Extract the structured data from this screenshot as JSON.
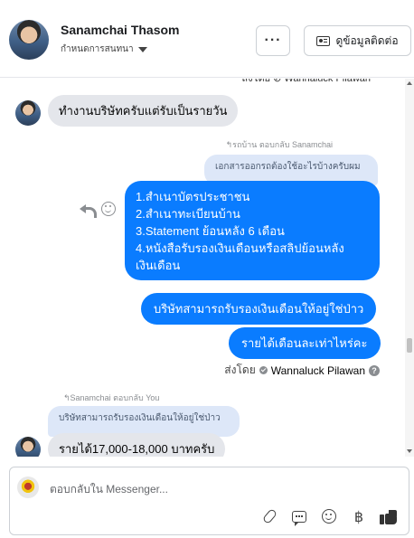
{
  "header": {
    "name": "Sanamchai Thasom",
    "subtitle": "กำหนดการสนทนา",
    "more_label": "···",
    "contact_label": "ดูข้อมูลติดต่อ"
  },
  "thread": {
    "cut_top_sender": "ส่งโดย ⊘ Wannaluck Pilawan",
    "messages": {
      "m1": {
        "text": "ทำงานบริษัทครับแต่รับเป็นรายวัน"
      },
      "m2": {
        "reply_label": "↰รถบ้าน ตอบกลับ Sanamchai",
        "quote": "เอกสารออกรถต้องใช้อะไรบ้างครับผม",
        "lines": [
          "1.สำเนาบัตรประชาชน",
          "2.สำเนาทะเบียนบ้าน",
          "3.Statement ย้อนหลัง 6 เดือน",
          "4.หนังสือรับรองเงินเดือนหรือสลิปย้อนหลัง",
          "เงินเดือน"
        ]
      },
      "m3": {
        "text": "บริษัทสามารถรับรองเงินเดือนให้อยู่ใช่ป่าว"
      },
      "m4": {
        "text": "รายได้เดือนละเท่าไหร่คะ"
      },
      "sent_by": {
        "prefix": "ส่งโดย",
        "name": "Wannaluck Pilawan",
        "help": "?"
      },
      "m5": {
        "reply_label": "↰Sanamchai ตอบกลับ You",
        "quote": "บริษัทสามารถรับรองเงินเดือนให้อยู่ใช่ป่าว",
        "text": "รายได้17,000-18,000 บาทครับ"
      }
    }
  },
  "composer": {
    "placeholder": "ตอบกลับใน Messenger..."
  },
  "icons": [
    "avatar",
    "chevron-down-icon",
    "more-icon",
    "contact-card-icon",
    "reply-icon",
    "react-smile-icon",
    "check-icon",
    "help-icon",
    "attach-icon",
    "saved-reply-icon",
    "emoji-icon",
    "baht-icon",
    "like-icon"
  ],
  "colors": {
    "outgoing": "#0a7cff",
    "incoming": "#e4e6eb",
    "quote": "#dde7f8"
  }
}
